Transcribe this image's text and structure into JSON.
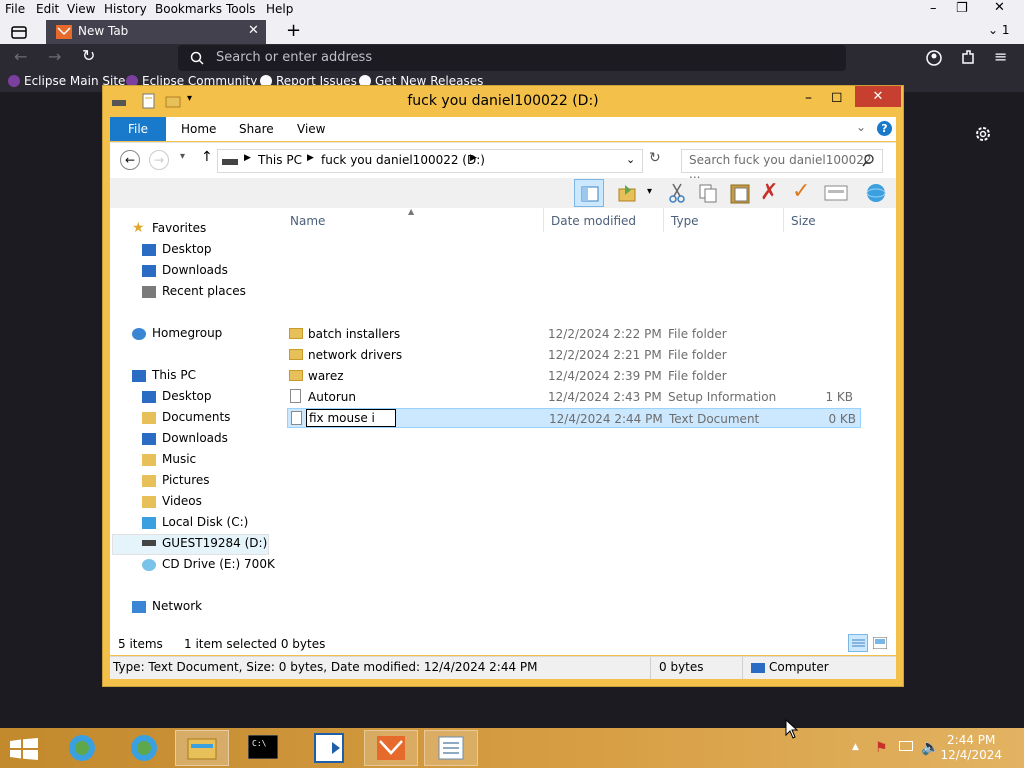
{
  "browser": {
    "menu": [
      "File",
      "Edit",
      "View",
      "History",
      "Bookmarks",
      "Tools",
      "Help"
    ],
    "tab_title": "New Tab",
    "tab_count": "1",
    "urlbar_placeholder": "Search or enter address",
    "bookmarks": [
      "Eclipse Main Site",
      "Eclipse Community",
      "Report Issues",
      "Get New Releases"
    ]
  },
  "explorer": {
    "title": "fuck you daniel100022 (D:)",
    "ribbon_tabs": [
      "File",
      "Home",
      "Share",
      "View"
    ],
    "breadcrumb": [
      "This PC",
      "fuck you daniel100022 (D:)"
    ],
    "search_placeholder": "Search fuck you daniel100022 ...",
    "nav": {
      "favorites": "Favorites",
      "favorites_items": [
        "Desktop",
        "Downloads",
        "Recent places"
      ],
      "homegroup": "Homegroup",
      "thispc": "This PC",
      "thispc_items": [
        "Desktop",
        "Documents",
        "Downloads",
        "Music",
        "Pictures",
        "Videos",
        "Local Disk (C:)",
        "GUEST19284 (D:)",
        "CD Drive (E:) 700K"
      ],
      "network": "Network"
    },
    "columns": {
      "name": "Name",
      "date": "Date modified",
      "type": "Type",
      "size": "Size"
    },
    "files": [
      {
        "name": "batch installers",
        "date": "12/2/2024 2:22 PM",
        "type": "File folder",
        "size": "",
        "kind": "folder"
      },
      {
        "name": "network drivers",
        "date": "12/2/2024 2:21 PM",
        "type": "File folder",
        "size": "",
        "kind": "folder"
      },
      {
        "name": "warez",
        "date": "12/4/2024 2:39 PM",
        "type": "File folder",
        "size": "",
        "kind": "folder"
      },
      {
        "name": "Autorun",
        "date": "12/4/2024 2:43 PM",
        "type": "Setup Information",
        "size": "1 KB",
        "kind": "file"
      }
    ],
    "selected_file": {
      "rename_value": "fix mouse i",
      "date": "12/4/2024 2:44 PM",
      "type": "Text Document",
      "size": "0 KB"
    },
    "status": {
      "items": "5 items",
      "selected": "1 item selected  0 bytes"
    },
    "details_bar": {
      "info": "Type: Text Document, Size: 0 bytes, Date modified: 12/4/2024 2:44 PM",
      "bytes": "0 bytes",
      "location": "Computer"
    }
  },
  "taskbar": {
    "time": "2:44 PM",
    "date": "12/4/2024"
  },
  "colors": {
    "accent": "#1979ca",
    "window_frame": "#f3c04a",
    "taskbar": "#d89f45",
    "selection": "#cce8ff"
  }
}
